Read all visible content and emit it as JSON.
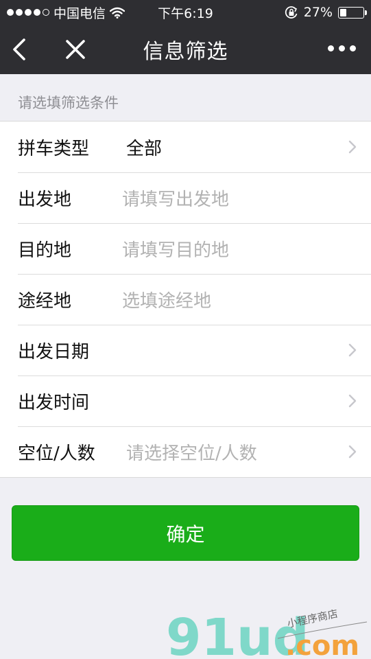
{
  "statusbar": {
    "carrier": "中国电信",
    "time": "下午6:19",
    "battery_percent": "27%",
    "battery_level": 0.27
  },
  "navbar": {
    "title": "信息筛选"
  },
  "section_hint": "请选填筛选条件",
  "form": {
    "rows": [
      {
        "label": "拼车类型",
        "value": "全部",
        "placeholder": ""
      },
      {
        "label": "出发地",
        "value": "",
        "placeholder": "请填写出发地"
      },
      {
        "label": "目的地",
        "value": "",
        "placeholder": "请填写目的地"
      },
      {
        "label": "途经地",
        "value": "",
        "placeholder": "选填途经地"
      },
      {
        "label": "出发日期",
        "value": "",
        "placeholder": ""
      },
      {
        "label": "出发时间",
        "value": "",
        "placeholder": ""
      },
      {
        "label": "空位/人数",
        "value": "",
        "placeholder": "请选择空位/人数"
      }
    ]
  },
  "confirm_label": "确定",
  "watermark": {
    "brand": "91ud",
    "suffix": ".com",
    "tagline": "小程序商店"
  },
  "colors": {
    "navbar_bg": "#2e2e32",
    "page_bg": "#efeff4",
    "primary_green": "#1aad19",
    "placeholder_gray": "#b2b2b2"
  }
}
